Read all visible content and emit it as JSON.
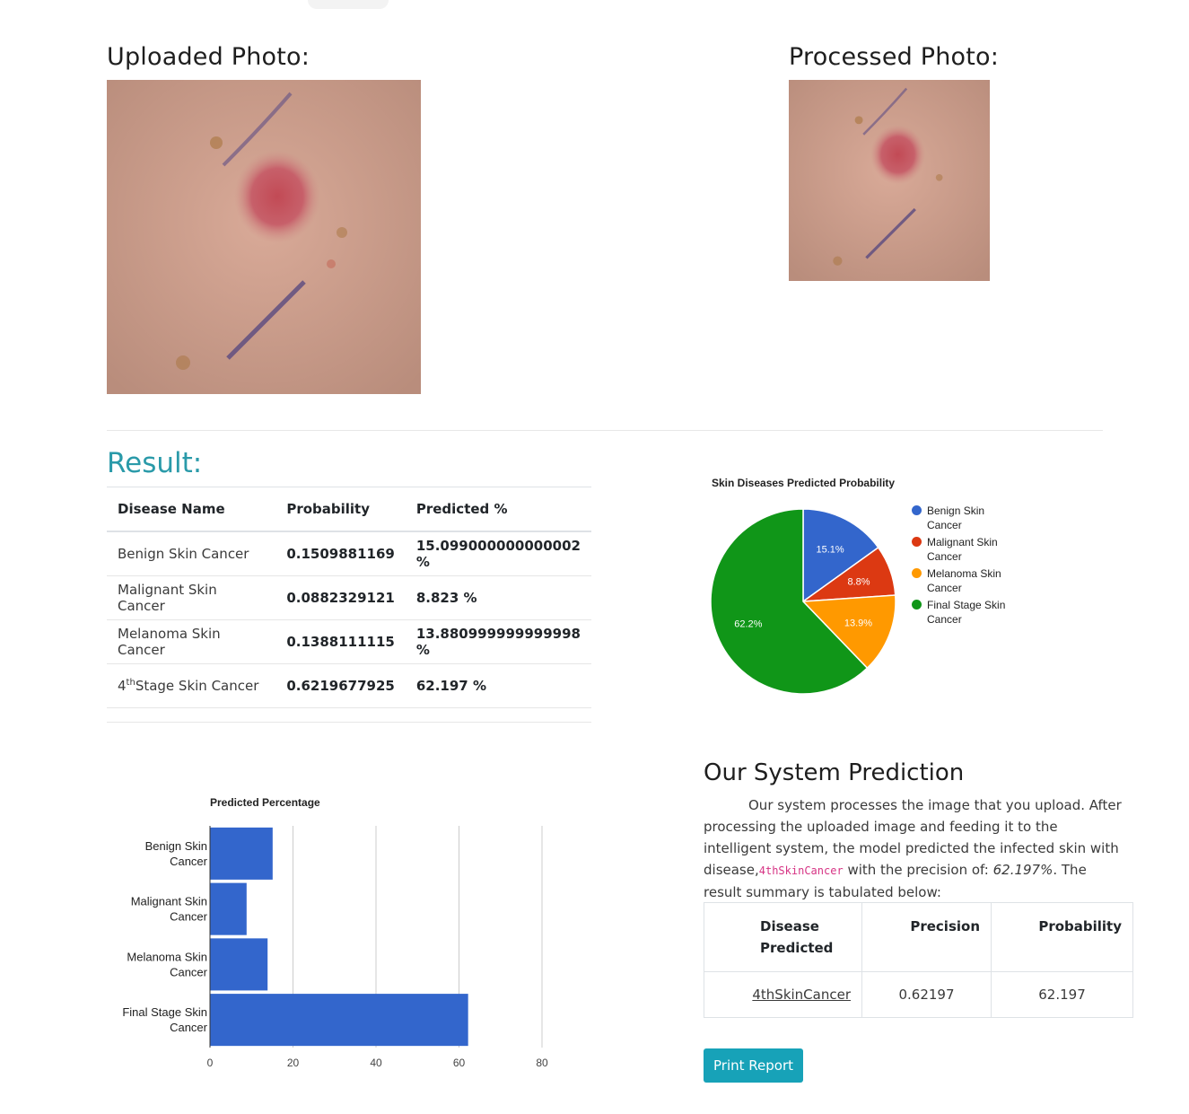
{
  "photos": {
    "uploaded_title": "Uploaded Photo:",
    "processed_title": "Processed Photo:"
  },
  "result": {
    "title": "Result:",
    "columns": [
      "Disease Name",
      "Probability",
      "Predicted %"
    ],
    "rows": [
      {
        "name": "Benign Skin Cancer",
        "probability": "0.1509881169",
        "predicted": "15.099000000000002 %"
      },
      {
        "name": "Malignant Skin Cancer",
        "probability": "0.0882329121",
        "predicted": "8.823 %"
      },
      {
        "name": "Melanoma Skin Cancer",
        "probability": "0.1388111115",
        "predicted": "13.880999999999998 %"
      },
      {
        "name_prefix": "4",
        "name_sup": "th",
        "name_suffix": "Stage Skin Cancer",
        "probability": "0.6219677925",
        "predicted": "62.197 %"
      }
    ]
  },
  "chart_data": [
    {
      "type": "pie",
      "title": "Skin Diseases Predicted Probability",
      "categories": [
        "Benign Skin Cancer",
        "Malignant Skin Cancer",
        "Melanoma Skin Cancer",
        "Final Stage Skin Cancer"
      ],
      "values": [
        15.099,
        8.823,
        13.881,
        62.197
      ],
      "data_labels": [
        "15.1%",
        "8.8%",
        "13.9%",
        "62.2%"
      ],
      "colors": [
        "#3366cc",
        "#dc3912",
        "#ff9900",
        "#109618"
      ],
      "legend": "right"
    },
    {
      "type": "bar",
      "orientation": "horizontal",
      "title": "Predicted Percentage",
      "categories": [
        "Benign Skin Cancer",
        "Malignant Skin Cancer",
        "Melanoma Skin Cancer",
        "Final Stage Skin Cancer"
      ],
      "category_lines": [
        [
          "Benign Skin",
          "Cancer"
        ],
        [
          "Malignant Skin",
          "Cancer"
        ],
        [
          "Melanoma Skin",
          "Cancer"
        ],
        [
          "Final Stage Skin",
          "Cancer"
        ]
      ],
      "values": [
        15.099,
        8.823,
        13.881,
        62.197
      ],
      "xlim": [
        0,
        80
      ],
      "xticks": [
        "0",
        "20",
        "40",
        "60",
        "80"
      ],
      "color": "#3366cc",
      "grid": true
    }
  ],
  "system": {
    "title": "Our System Prediction",
    "para_1": "Our system processes the image that you upload. After processing the uploaded image and feeding it to the intelligent system, the model predicted the infected skin with disease,",
    "code": "4thSkinCancer",
    "para_2": " with the precision of: ",
    "precision_em": "62.197%",
    "para_3": ". The result summary is tabulated below:",
    "table_headers": [
      "Disease Predicted",
      "Precision",
      "Probability"
    ],
    "table_row": {
      "disease": "4thSkinCancer",
      "precision": "0.62197",
      "probability": "62.197"
    }
  },
  "print_button": "Print Report"
}
